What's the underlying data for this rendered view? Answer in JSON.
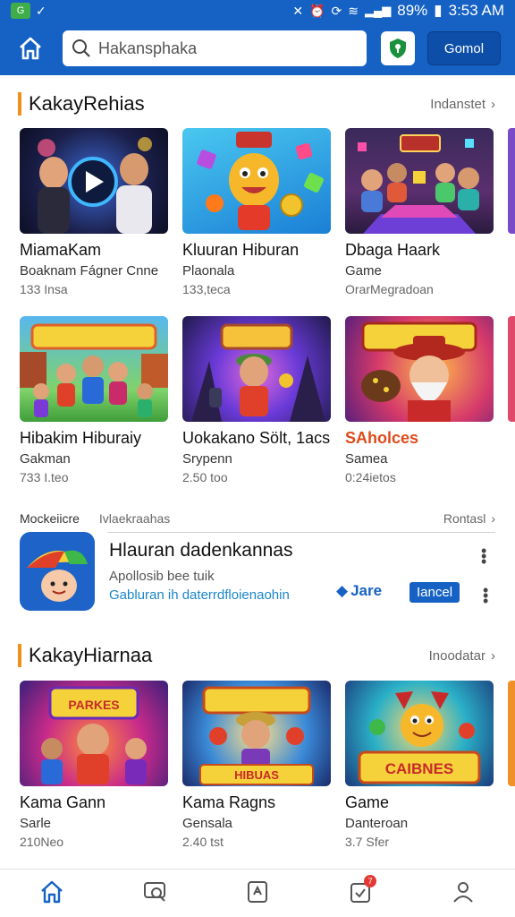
{
  "status_bar": {
    "app_badge": "G",
    "battery": "89%",
    "time": "3:53 AM"
  },
  "top_bar": {
    "search_placeholder": "Hakansphaka",
    "cta_label": "Gomol"
  },
  "section1": {
    "title": "KakayRehias",
    "see_all": "Indanstet",
    "row1": [
      {
        "title": "MiamaKam",
        "sub": "Boaknam Fágner Cnne",
        "meta": "133 Insa"
      },
      {
        "title": "Kluuran Hiburan",
        "sub": "Plaonala",
        "meta": "133,teca"
      },
      {
        "title": "Dbaga Haark",
        "sub": "Game",
        "meta": "OrarMegradoan"
      }
    ],
    "row2": [
      {
        "title": "Hibakim Hiburaiy",
        "sub": "Gakman",
        "meta": "733 I.teo"
      },
      {
        "title": "Uokakano Sölt, 1acs",
        "sub": "Srypenn",
        "meta": "2.50 too"
      },
      {
        "title": "SAholces",
        "sub": "Samea",
        "meta": "0:24ietos"
      }
    ]
  },
  "promo": {
    "tab1": "Mockeiicre",
    "tab2": "Ivlaekraahas",
    "tab3": "Rontasl",
    "title": "Hlauran dadenkannas",
    "sub": "Apollosib bee tuik",
    "link": "Gabluran ih daterrdfloienaohin",
    "share_label": "Jare",
    "cancel_label": "Iancel"
  },
  "section2": {
    "title": "KakayHiarnaa",
    "see_all": "Inoodatar",
    "cards": [
      {
        "title": "Kama Gann",
        "sub": "Sarle",
        "meta": "210Neo"
      },
      {
        "title": "Kama Ragns",
        "sub": "Gensala",
        "meta": "2.40 tst"
      },
      {
        "title": "Game",
        "sub": "Danteroan",
        "meta": "3.7 Sfer"
      }
    ],
    "thumb_texts": [
      "PARKES",
      "HIBUAS",
      "CAIBNES"
    ]
  },
  "bottom_nav": {
    "badge": "7"
  },
  "colors": {
    "brand_blue": "#1662c4",
    "accent_orange": "#f0901a"
  }
}
